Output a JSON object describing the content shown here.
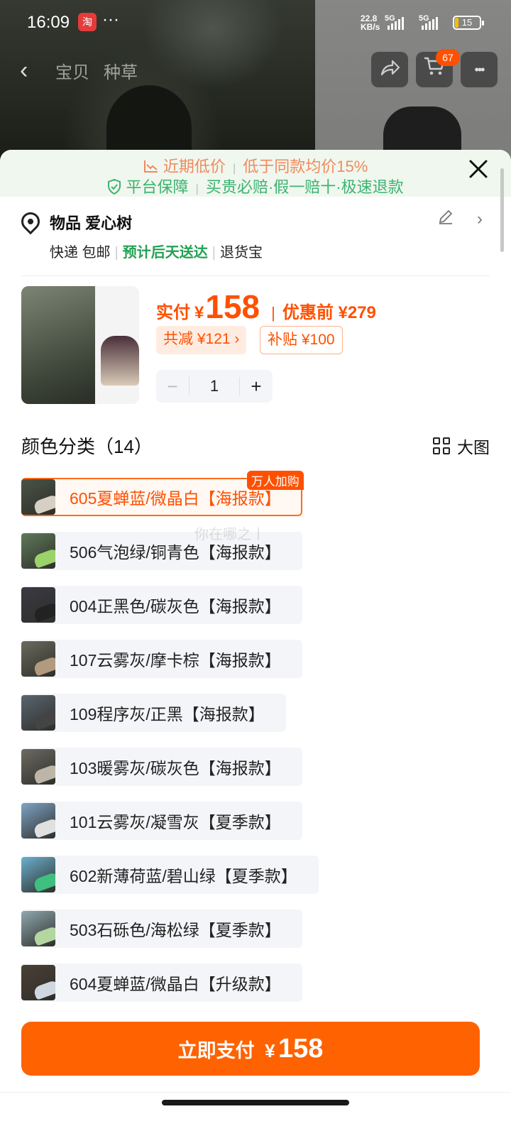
{
  "status": {
    "time": "16:09",
    "app_icon_text": "淘",
    "dots": "···",
    "speed_value": "22.8",
    "speed_unit": "KB/s",
    "sig1": "5G",
    "sig2": "5G",
    "battery": "15"
  },
  "nav": {
    "back": "‹",
    "tab1": "宝贝",
    "tab2": "种草",
    "share_icon": "share-icon",
    "cart_count": "67",
    "more": "•••"
  },
  "promo": {
    "line1_a": "近期低价",
    "line1_b": "低于同款均价15%",
    "line2_a": "平台保障",
    "line2_b": "买贵必赔·假一赔十·极速退款",
    "sep": "|"
  },
  "address": {
    "name": "物品 爱心树",
    "ship_a": "快递 包邮",
    "ship_b": "预计后天送达",
    "ship_c": "退货宝",
    "sep": "|"
  },
  "product": {
    "pay_label": "实付",
    "currency": "¥",
    "pay_price": "158",
    "divider": "|",
    "orig_label": "优惠前 ¥279",
    "reduce_chip": "共减 ¥121 ›",
    "subsidy_chip": "补贴 ¥100",
    "qty_minus": "−",
    "qty": "1",
    "qty_plus": "+"
  },
  "variants": {
    "title": "颜色分类（14）",
    "big_view": "大图",
    "badge": "万人加购",
    "watermark": "你在哪之丨",
    "items": [
      {
        "label": "605夏蝉蓝/微晶白【海报款】",
        "selected": true
      },
      {
        "label": "506气泡绿/铜青色【海报款】"
      },
      {
        "label": "004正黑色/碳灰色【海报款】"
      },
      {
        "label": "107云雾灰/摩卡棕【海报款】"
      },
      {
        "label": "109程序灰/正黑【海报款】"
      },
      {
        "label": "103暖雾灰/碳灰色【海报款】"
      },
      {
        "label": "101云雾灰/凝雪灰【夏季款】"
      },
      {
        "label": "602新薄荷蓝/碧山绿【夏季款】"
      },
      {
        "label": "503石砾色/海松绿【夏季款】"
      },
      {
        "label": "604夏蝉蓝/微晶白【升级款】"
      }
    ]
  },
  "pay_button": {
    "label": "立即支付",
    "currency": "¥",
    "amount": "158"
  },
  "colors": {
    "accent": "#ff5000",
    "pay_button": "#ff6200",
    "delivery_green": "#22a052",
    "promo_bg": "#f0f7ee"
  }
}
